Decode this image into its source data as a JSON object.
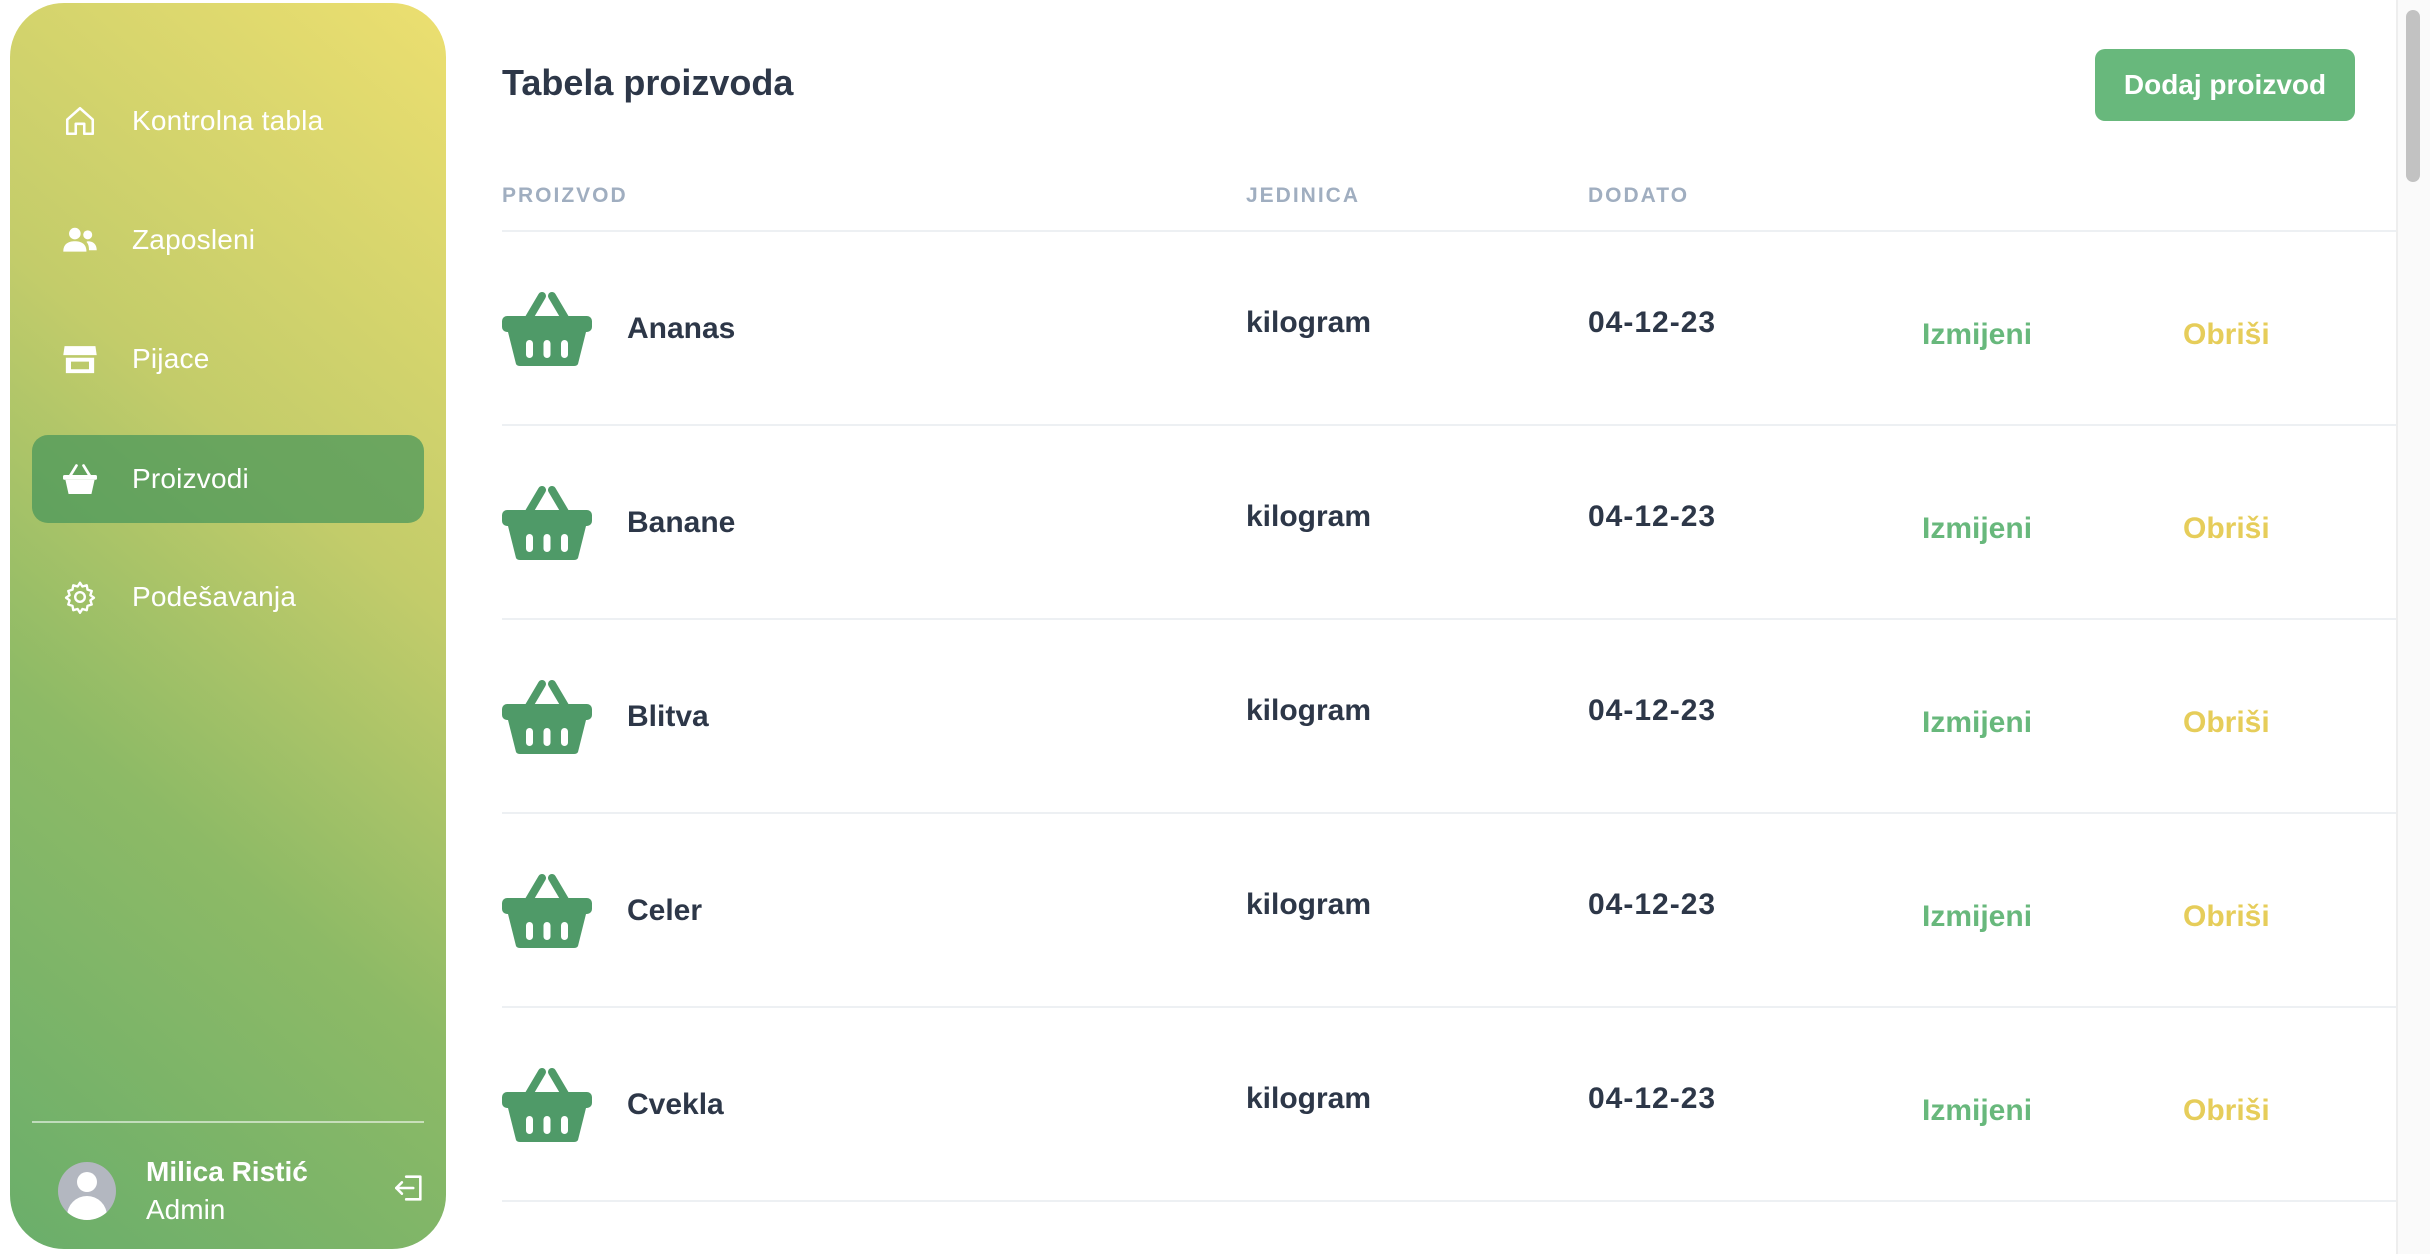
{
  "sidebar": {
    "items": [
      {
        "label": "Kontrolna tabla",
        "icon": "home-icon"
      },
      {
        "label": "Zaposleni",
        "icon": "users-icon"
      },
      {
        "label": "Pijace",
        "icon": "store-icon"
      },
      {
        "label": "Proizvodi",
        "icon": "basket-icon",
        "active": true
      },
      {
        "label": "Podešavanja",
        "icon": "gear-icon"
      }
    ],
    "user": {
      "name": "Milica Ristić",
      "role": "Admin"
    }
  },
  "main": {
    "title": "Tabela proizvoda",
    "add_button_label": "Dodaj proizvod",
    "columns": [
      "PROIZVOD",
      "JEDINICA",
      "DODATO"
    ],
    "rows": [
      {
        "name": "Ananas",
        "unit": "kilogram",
        "date": "04-12-23",
        "edit": "Izmijeni",
        "delete": "Obriši"
      },
      {
        "name": "Banane",
        "unit": "kilogram",
        "date": "04-12-23",
        "edit": "Izmijeni",
        "delete": "Obriši"
      },
      {
        "name": "Blitva",
        "unit": "kilogram",
        "date": "04-12-23",
        "edit": "Izmijeni",
        "delete": "Obriši"
      },
      {
        "name": "Celer",
        "unit": "kilogram",
        "date": "04-12-23",
        "edit": "Izmijeni",
        "delete": "Obriši"
      },
      {
        "name": "Cvekla",
        "unit": "kilogram",
        "date": "04-12-23",
        "edit": "Izmijeni",
        "delete": "Obriši"
      }
    ]
  },
  "colors": {
    "accent_green": "#68b87c",
    "icon_green": "#4f9a68",
    "delete_yellow": "#e6cd5a",
    "text_dark": "#2d3748",
    "header_gray": "#a0aec0"
  }
}
